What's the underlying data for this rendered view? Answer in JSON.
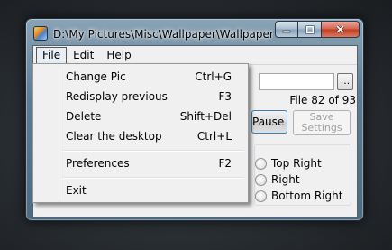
{
  "window": {
    "title": "D:\\My Pictures\\Misc\\Wallpaper\\Wallpaper (…",
    "icon": "wallpaper-app-icon"
  },
  "menubar": {
    "file": "File",
    "edit": "Edit",
    "help": "Help"
  },
  "file_menu": {
    "items": [
      {
        "label": "Change Pic",
        "shortcut": "Ctrl+G"
      },
      {
        "label": "Redisplay previous",
        "shortcut": "F3"
      },
      {
        "label": "Delete",
        "shortcut": "Shift+Del"
      },
      {
        "label": "Clear the desktop",
        "shortcut": "Ctrl+L"
      },
      {
        "label": "Preferences",
        "shortcut": "F2"
      },
      {
        "label": "Exit",
        "shortcut": ""
      }
    ]
  },
  "main": {
    "path_value": "",
    "browse_label": "...",
    "file_count": "File 82 of 93",
    "pause_label": "Pause",
    "save_settings_line1": "Save",
    "save_settings_line2": "Settings",
    "position_options": [
      "Top Right",
      "Right",
      "Bottom Right"
    ]
  }
}
